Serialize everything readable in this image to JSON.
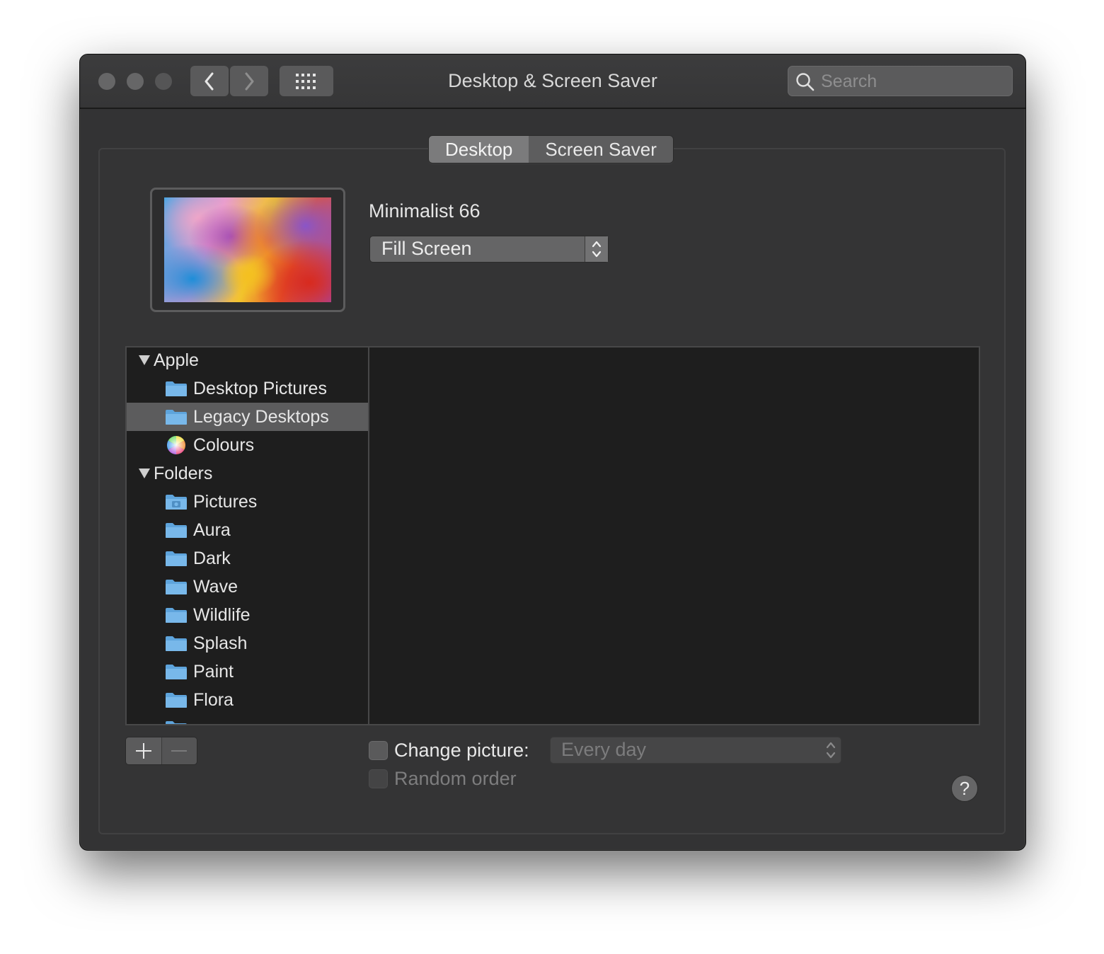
{
  "window": {
    "title": "Desktop & Screen Saver",
    "search_placeholder": "Search"
  },
  "tabs": [
    {
      "label": "Desktop",
      "active": true
    },
    {
      "label": "Screen Saver",
      "active": false
    }
  ],
  "current_picture": {
    "name": "Minimalist 66",
    "fit_mode": "Fill Screen"
  },
  "sources": {
    "groups": [
      {
        "label": "Apple",
        "expanded": true,
        "items": [
          {
            "label": "Desktop Pictures",
            "icon": "folder-icon",
            "selected": false
          },
          {
            "label": "Legacy Desktops",
            "icon": "folder-icon",
            "selected": true
          },
          {
            "label": "Colours",
            "icon": "color-wheel-icon",
            "selected": false
          }
        ]
      },
      {
        "label": "Folders",
        "expanded": true,
        "items": [
          {
            "label": "Pictures",
            "icon": "pictures-folder-icon",
            "selected": false
          },
          {
            "label": "Aura",
            "icon": "folder-icon",
            "selected": false
          },
          {
            "label": "Dark",
            "icon": "folder-icon",
            "selected": false
          },
          {
            "label": "Wave",
            "icon": "folder-icon",
            "selected": false
          },
          {
            "label": "Wildlife",
            "icon": "folder-icon",
            "selected": false
          },
          {
            "label": "Splash",
            "icon": "folder-icon",
            "selected": false
          },
          {
            "label": "Paint",
            "icon": "folder-icon",
            "selected": false
          },
          {
            "label": "Flora",
            "icon": "folder-icon",
            "selected": false
          }
        ]
      }
    ]
  },
  "controls": {
    "add_label": "+",
    "remove_label": "−",
    "change_picture_label": "Change picture:",
    "change_picture_checked": false,
    "interval": "Every day",
    "random_order_label": "Random order",
    "random_order_checked": false,
    "help_label": "?"
  },
  "colors": {
    "window_bg": "#333334",
    "list_bg": "#1e1e1e",
    "selection": "#5c5c5d",
    "folder_blue": "#6fb3e6"
  }
}
